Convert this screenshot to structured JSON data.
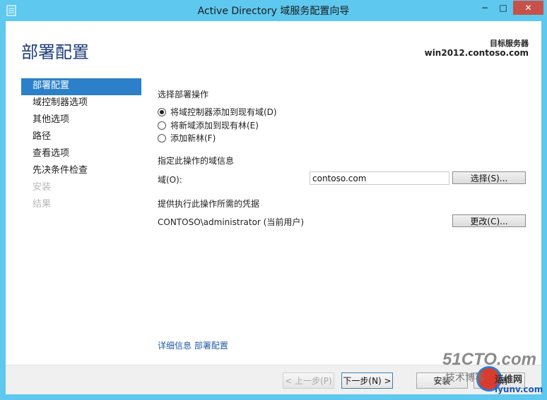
{
  "window": {
    "title": "Active Directory 域服务配置向导",
    "minimize": "−",
    "maximize": "□",
    "close": "✕"
  },
  "header": {
    "page_title": "部署配置",
    "target_label": "目标服务器",
    "target_server": "win2012.contoso.com"
  },
  "nav": {
    "items": [
      {
        "label": "部署配置",
        "state": "active"
      },
      {
        "label": "域控制器选项",
        "state": "normal"
      },
      {
        "label": "其他选项",
        "state": "normal"
      },
      {
        "label": "路径",
        "state": "normal"
      },
      {
        "label": "查看选项",
        "state": "normal"
      },
      {
        "label": "先决条件检查",
        "state": "normal"
      },
      {
        "label": "安装",
        "state": "disabled"
      },
      {
        "label": "结果",
        "state": "disabled"
      }
    ]
  },
  "main": {
    "operation_heading": "选择部署操作",
    "options": [
      {
        "label": "将域控制器添加到现有域(D)",
        "checked": true
      },
      {
        "label": "将新域添加到现有林(E)",
        "checked": false
      },
      {
        "label": "添加新林(F)",
        "checked": false
      }
    ],
    "domain_info_heading": "指定此操作的域信息",
    "domain_label": "域(O):",
    "domain_value": "contoso.com",
    "select_button": "选择(S)...",
    "credentials_heading": "提供执行此操作所需的凭据",
    "credentials_value": "CONTOSO\\administrator (当前用户)",
    "change_button": "更改(C)...",
    "more_info_link": "详细信息 部署配置"
  },
  "footer": {
    "prev": "< 上一步(P)",
    "next": "下一步(N) >",
    "install": "安装",
    "cancel": "取消"
  },
  "watermark": {
    "logo": "51CTO.com",
    "text1": "技术博客",
    "text2": "运维网",
    "url": "iyunv.com"
  }
}
